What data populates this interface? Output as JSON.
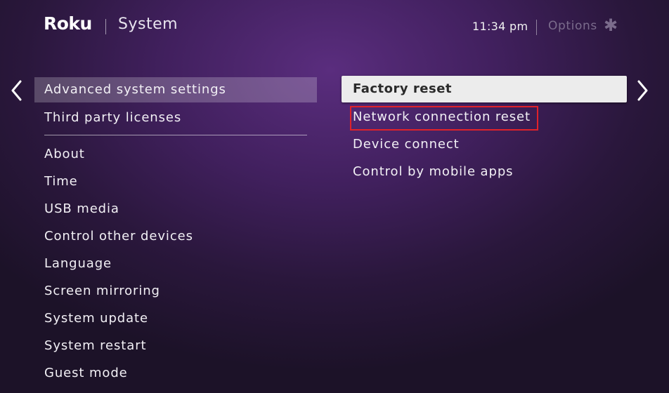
{
  "header": {
    "logo_text": "Roku",
    "title": "System",
    "clock": "11:34 pm",
    "options_label": "Options",
    "options_icon": "✱"
  },
  "nav": {
    "left_icon": "chevron-left-icon",
    "right_icon": "chevron-right-icon"
  },
  "left_menu": {
    "items": [
      {
        "label": "Advanced system settings",
        "focused": true
      },
      {
        "label": "Third party licenses"
      },
      {
        "label": "About"
      },
      {
        "label": "Time"
      },
      {
        "label": "USB media"
      },
      {
        "label": "Control other devices"
      },
      {
        "label": "Language"
      },
      {
        "label": "Screen mirroring"
      },
      {
        "label": "System update"
      },
      {
        "label": "System restart"
      },
      {
        "label": "Guest mode"
      }
    ]
  },
  "right_menu": {
    "items": [
      {
        "label": "Factory reset",
        "selected": true
      },
      {
        "label": "Network connection reset",
        "highlighted": true
      },
      {
        "label": "Device connect"
      },
      {
        "label": "Control by mobile apps"
      }
    ]
  },
  "colors": {
    "highlight_border": "#e0222a",
    "selected_bg": "#ececec",
    "background_purple": "#41205e"
  }
}
